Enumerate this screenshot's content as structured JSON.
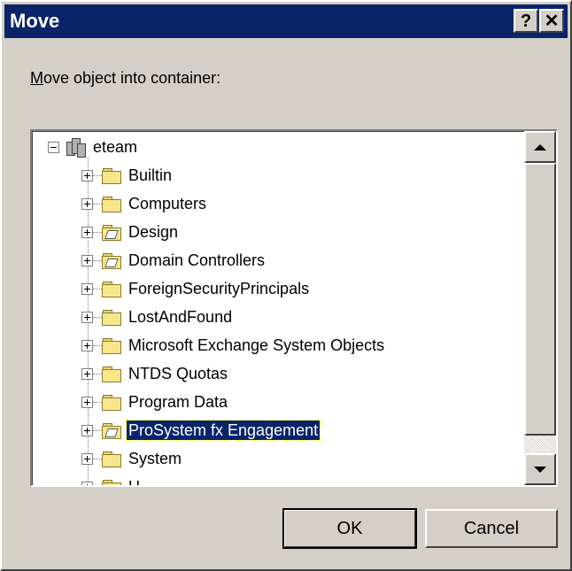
{
  "window": {
    "title": "Move",
    "help_glyph": "?",
    "close_glyph": "✕"
  },
  "prompt": {
    "mnemonic": "M",
    "rest": "ove object into container:"
  },
  "tree": {
    "root": {
      "label": "eteam",
      "icon": "domain-icon"
    },
    "items": [
      {
        "label": "Builtin",
        "icon": "folder-icon"
      },
      {
        "label": "Computers",
        "icon": "folder-icon"
      },
      {
        "label": "Design",
        "icon": "ou-folder-icon"
      },
      {
        "label": "Domain Controllers",
        "icon": "ou-folder-icon"
      },
      {
        "label": "ForeignSecurityPrincipals",
        "icon": "folder-icon"
      },
      {
        "label": "LostAndFound",
        "icon": "folder-icon"
      },
      {
        "label": "Microsoft Exchange System Objects",
        "icon": "folder-icon"
      },
      {
        "label": "NTDS Quotas",
        "icon": "folder-icon"
      },
      {
        "label": "Program Data",
        "icon": "folder-icon"
      },
      {
        "label": "ProSystem fx Engagement",
        "icon": "ou-folder-icon",
        "selected": true
      },
      {
        "label": "System",
        "icon": "folder-icon"
      },
      {
        "label": "U",
        "icon": "folder-icon"
      }
    ]
  },
  "buttons": {
    "ok": "OK",
    "cancel": "Cancel"
  },
  "colors": {
    "titlebar": "#0a246a",
    "selection": "#0a246a",
    "face": "#d4d0c8"
  }
}
